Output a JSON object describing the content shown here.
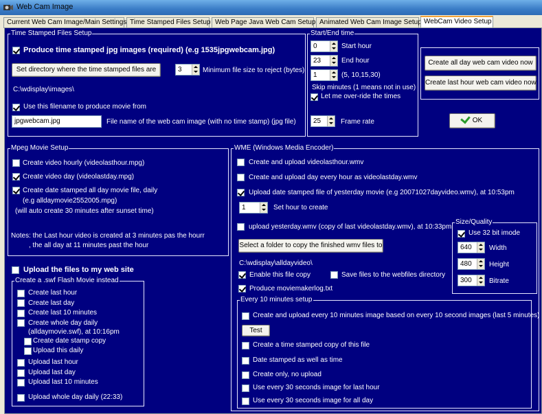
{
  "window": {
    "title": "Web Cam Image"
  },
  "tabs": [
    {
      "label": "Current Web Cam Image/Main Settings"
    },
    {
      "label": "Time Stamped Files Setup"
    },
    {
      "label": "Web Page Java Web Cam Setup"
    },
    {
      "label": "Animated Web Cam Image Setup"
    },
    {
      "label": "WebCam Video Setup"
    }
  ],
  "ts": {
    "group": "Time Stamped Files Setup",
    "produce_label": "Produce time stamped jpg images (required) (e.g 1535jpgwebcam.jpg)",
    "produce_checked": true,
    "set_dir_button": "Set directory where the time stamped files are",
    "min_size_value": "3",
    "min_size_label": "Minimum file size to reject (bytes)",
    "dir_path": "C:\\wdisplay\\images\\",
    "use_filename_label": "Use this filename to produce movie from",
    "use_filename_checked": true,
    "filename_value": "jpgwebcam.jpg",
    "filename_label": "File name of the web cam image (with no time stamp) (jpg file)"
  },
  "se": {
    "group": "Start/End time",
    "start_value": "0",
    "start_label": "Start hour",
    "end_value": "23",
    "end_label": "End hour",
    "skip_value": "1",
    "skip_options": "(5, 10,15,30)",
    "skip_label": "Skip minutes (1 means not in use)",
    "override_label": "Let me over-ride the times",
    "override_checked": true,
    "frame_value": "25",
    "frame_label": "Frame rate"
  },
  "actions": {
    "all_day_button": "Create all day web cam video now",
    "last_hour_button": "Create last hour web cam video now",
    "ok_button": "OK"
  },
  "mpeg": {
    "group": "Mpeg Movie Setup",
    "hourly": "Create video hourly (videolasthour.mpg)",
    "hourly_checked": false,
    "day": "Create video day  (videolastday.mpg)",
    "day_checked": true,
    "stamped": "Create date stamped all day movie file, daily",
    "stamped_checked": true,
    "stamped_eg": "(e.g alldaymovie2552005.mpg)",
    "stamped_note": "(will auto create 30 minutes after sunset time)",
    "notes1": "Notes: the Last hour video is created at 3 minutes pas the hourr",
    "notes2": ", the all day at 11 minutes past the hour"
  },
  "upload": {
    "label": "Upload the files to my web site",
    "checked": false
  },
  "swf": {
    "group": "Create a .swf Flash Movie instead",
    "items": [
      {
        "label": "Create last hour"
      },
      {
        "label": "Create last day"
      },
      {
        "label": "Create last 10 minutes"
      },
      {
        "label": "Create whole day daily"
      }
    ],
    "whole_day_note": "(alldaymovie.swf), at 10:16pm",
    "date_stamp_copy": "Create date stamp copy",
    "upload_daily": "Upload this daily",
    "uploads": [
      {
        "label": "Upload last hour"
      },
      {
        "label": "Upload last day"
      },
      {
        "label": "Upload last 10 minutes"
      }
    ],
    "upload_whole": "Upload whole day daily (22:33)"
  },
  "wme": {
    "group": "WME (Windows Media Encoder)",
    "last_hour": "Create and upload videolasthour.wmv",
    "last_hour_checked": false,
    "day_every_hour": "Create and upload day every hour as videolastday.wmv",
    "day_every_hour_checked": false,
    "date_stamped": "Upload date stamped file of yesterday movie (e.g 20071027dayvideo.wmv), at 10:53pm",
    "date_stamped_checked": true,
    "hour_value": "1",
    "hour_label": "Set hour to create",
    "yesterday": "upload yesterday.wmv (copy of last videolastday.wmv), at 10:33pm",
    "yesterday_checked": false,
    "folder_button": "Select a folder to copy the finished wmv files to",
    "folder_path": "C:\\wdisplay\\alldayvideo\\",
    "enable_copy": "Enable this file copy",
    "enable_copy_checked": true,
    "save_webfiles": "Save files to the webfiles directory",
    "save_webfiles_checked": false,
    "produce_log": "Produce moviemakerlog.txt",
    "produce_log_checked": true
  },
  "sq": {
    "group": "Size/Quality",
    "imode": "Use 32 bit imode",
    "imode_checked": true,
    "width_value": "640",
    "width_label": "Width",
    "height_value": "480",
    "height_label": "Height",
    "bitrate_value": "300",
    "bitrate_label": "Bitrate"
  },
  "ten": {
    "group": "Every 10 minutes setup",
    "create_upload": "Create and upload every 10 minutes image based on every 10 second images (last 5 minutes)",
    "test_button": "Test",
    "stamped_copy": "Create a time stamped copy of this file",
    "date_time": "Date stamped as well as time",
    "create_only": "Create only, no upload",
    "last_hour_30": "Use every 30 seconds image for last hour",
    "all_day_30": "Use every 30 seconds image for all day"
  }
}
